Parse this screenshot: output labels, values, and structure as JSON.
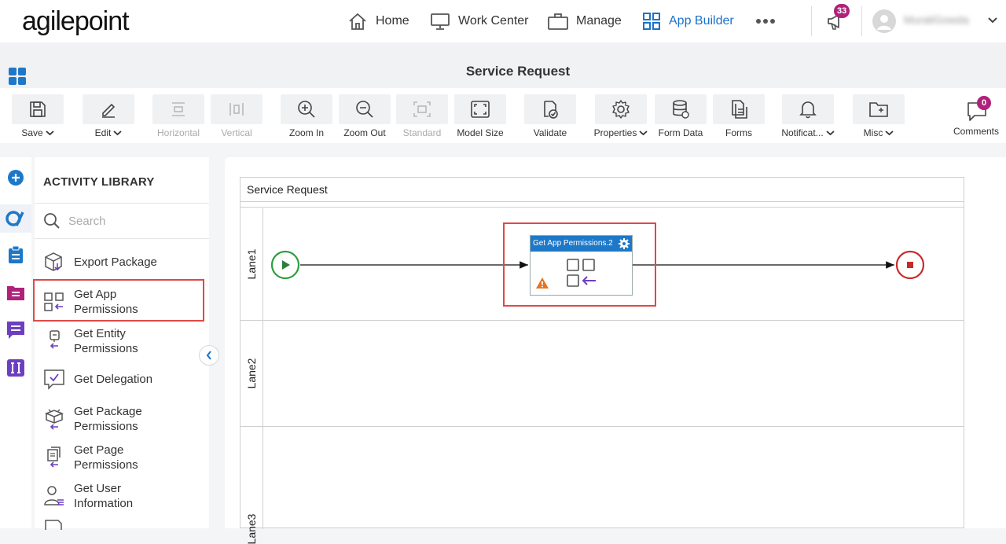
{
  "app": {
    "logo": "agilepoint"
  },
  "nav": {
    "items": [
      {
        "label": "Home",
        "icon": "home-icon"
      },
      {
        "label": "Work Center",
        "icon": "monitor-icon"
      },
      {
        "label": "Manage",
        "icon": "briefcase-icon"
      },
      {
        "label": "App Builder",
        "icon": "app-grid-icon",
        "active": true
      }
    ],
    "more_icon": "more-horizontal-icon",
    "notifications_count": "33",
    "user_name": "MuraliGowda"
  },
  "page": {
    "title": "Service Request"
  },
  "toolbar": {
    "items": [
      {
        "label": "Save",
        "dropdown": true
      },
      {
        "label": "Edit",
        "dropdown": true
      },
      {
        "label": "Horizontal",
        "disabled": true
      },
      {
        "label": "Vertical",
        "disabled": true
      },
      {
        "label": "Zoom In"
      },
      {
        "label": "Zoom Out"
      },
      {
        "label": "Standard",
        "disabled": true
      },
      {
        "label": "Model Size"
      },
      {
        "label": "Validate"
      },
      {
        "label": "Properties",
        "dropdown": true
      },
      {
        "label": "Form Data"
      },
      {
        "label": "Forms"
      },
      {
        "label": "Notificat...",
        "dropdown": true
      },
      {
        "label": "Misc",
        "dropdown": true
      }
    ],
    "comments": {
      "label": "Comments",
      "count": "0"
    }
  },
  "library": {
    "title": "ACTIVITY LIBRARY",
    "search_placeholder": "Search",
    "items": [
      {
        "line1": "Export Package",
        "line2": ""
      },
      {
        "line1": "Get App",
        "line2": "Permissions"
      },
      {
        "line1": "Get Entity",
        "line2": "Permissions"
      },
      {
        "line1": "Get Delegation",
        "line2": ""
      },
      {
        "line1": "Get Package",
        "line2": "Permissions"
      },
      {
        "line1": "Get Page",
        "line2": "Permissions"
      },
      {
        "line1": "Get User",
        "line2": "Information"
      }
    ]
  },
  "diagram": {
    "pool_title": "Service Request",
    "lanes": [
      "Lane1",
      "Lane2",
      "Lane3"
    ],
    "activity": {
      "title": "Get App Permissions.2"
    }
  },
  "colors": {
    "accent": "#1a73c9",
    "highlight": "#e04848",
    "start": "#2e9e3e",
    "end": "#c62b2b",
    "badge": "#b0217b"
  }
}
